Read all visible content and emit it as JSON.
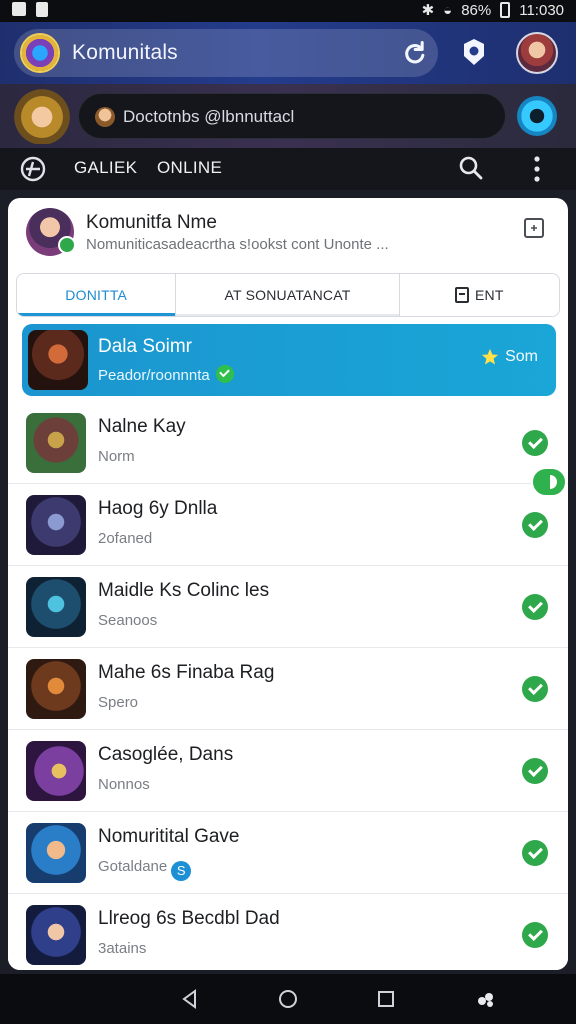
{
  "status_bar": {
    "battery": "86%",
    "time": "11:030"
  },
  "app_bar": {
    "title": "Komunitals",
    "icons": [
      "reload-icon",
      "settings-icon",
      "profile-avatar"
    ]
  },
  "hero": {
    "message": "Doctotnbs @lbnnuttacl"
  },
  "nav": {
    "tab1": "GALIEK",
    "tab2": "ONLINE"
  },
  "community": {
    "name": "Komunitfa Nme",
    "description": "Nomuniticasadeacrtha s!ookst cont Unonte ..."
  },
  "segments": [
    "DONITTA",
    "AT SONUATANCAT",
    "ENT"
  ],
  "list": [
    {
      "title": "Dala Soimr",
      "subtitle": "Peador/roonnnta",
      "badge": "Som",
      "selected": true
    },
    {
      "title": "Nalne Kay",
      "subtitle": "Norm"
    },
    {
      "title": "Haog 6y Dnlla",
      "subtitle": "2ofaned"
    },
    {
      "title": "Maidle Ks Colinc les",
      "subtitle": "Seanoos"
    },
    {
      "title": "Mahe 6s Finaba Rag",
      "subtitle": "Spero"
    },
    {
      "title": "Casoglée, Dans",
      "subtitle": "Nonnos"
    },
    {
      "title": "Nomuritital Gave",
      "subtitle": "Gotaldane"
    },
    {
      "title": "Llreog 6s Becdbl Dad",
      "subtitle": "3atains"
    }
  ],
  "colors": {
    "accent": "#1f95d6",
    "check": "#2ea84b",
    "appbar": "#243c8c"
  }
}
